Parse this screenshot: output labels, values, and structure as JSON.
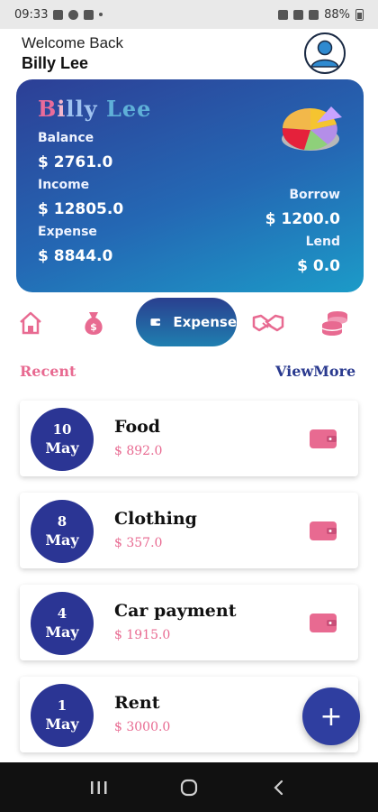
{
  "status_bar": {
    "time": "09:33",
    "battery": "88%"
  },
  "header": {
    "welcome": "Welcome Back",
    "user_name": "Billy Lee"
  },
  "summary": {
    "name_letters": [
      "B",
      "i",
      "lly",
      " Lee"
    ],
    "balance_label": "Balance",
    "balance_value": "$ 2761.0",
    "income_label": "Income",
    "income_value": "$ 12805.0",
    "expense_label": "Expense",
    "expense_value": "$ 8844.0",
    "borrow_label": "Borrow",
    "borrow_value": "$ 1200.0",
    "lend_label": "Lend",
    "lend_value": "$ 0.0"
  },
  "tabs": {
    "items": [
      {
        "icon": "home-icon"
      },
      {
        "icon": "money-bag-icon"
      },
      {
        "icon": "wallet-icon",
        "label": "Expense",
        "active": true
      },
      {
        "icon": "handshake-icon"
      },
      {
        "icon": "coins-icon"
      }
    ]
  },
  "recent": {
    "label": "Recent",
    "view_more": "ViewMore"
  },
  "transactions": [
    {
      "day": "10",
      "month": "May",
      "title": "Food",
      "amount": "$ 892.0"
    },
    {
      "day": "8",
      "month": "May",
      "title": "Clothing",
      "amount": "$ 357.0"
    },
    {
      "day": "4",
      "month": "May",
      "title": "Car payment",
      "amount": "$ 1915.0"
    },
    {
      "day": "1",
      "month": "May",
      "title": "Rent",
      "amount": "$ 3000.0"
    }
  ],
  "fab": {
    "label": "+"
  },
  "colors": {
    "accent_pink": "#e86a91",
    "brand_blue": "#2b3594",
    "card_gradient_end": "#1c9bc8"
  }
}
